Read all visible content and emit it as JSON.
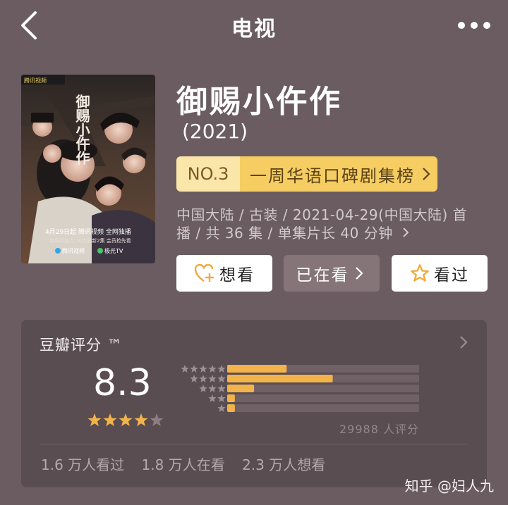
{
  "header": {
    "title": "电视"
  },
  "movie": {
    "title": "御赐小仵作",
    "year": "(2021)",
    "rank_no": "NO.3",
    "rank_list": "一周华语口碑剧集榜",
    "info_line1": "中国大陆 / 古装 / 2021-04-29(中国大陆) 首",
    "info_line2": "播 / 共 36 集 / 单集片长 40 分钟"
  },
  "poster": {
    "top_badge": "腾讯视频",
    "title_chars": "御赐小仵作",
    "date_line": "4月29日起 腾讯视频 全网独播",
    "schedule_line": "每周四五六 20点更新2集 会员抢先看",
    "brands": [
      "腾讯视频",
      "极光TV"
    ]
  },
  "actions": {
    "want": "想看",
    "watching": "已在看",
    "watched": "看过"
  },
  "rating": {
    "label": "豆瓣评分 ™",
    "score": "8.3",
    "star_fraction": 0.83,
    "distribution": [
      0.31,
      0.55,
      0.14,
      0.04,
      0.04
    ],
    "count_text": "29988 人评分",
    "stats": {
      "watched": "1.6 万人看过",
      "watching": "1.8 万人在看",
      "want": "2.3 万人想看"
    }
  },
  "watermark": "知乎 @妇人九",
  "colors": {
    "background": "#6a5c61",
    "card": "#5a4d52",
    "accent": "#f2b34a",
    "rank_badge": "#f6cd62"
  }
}
